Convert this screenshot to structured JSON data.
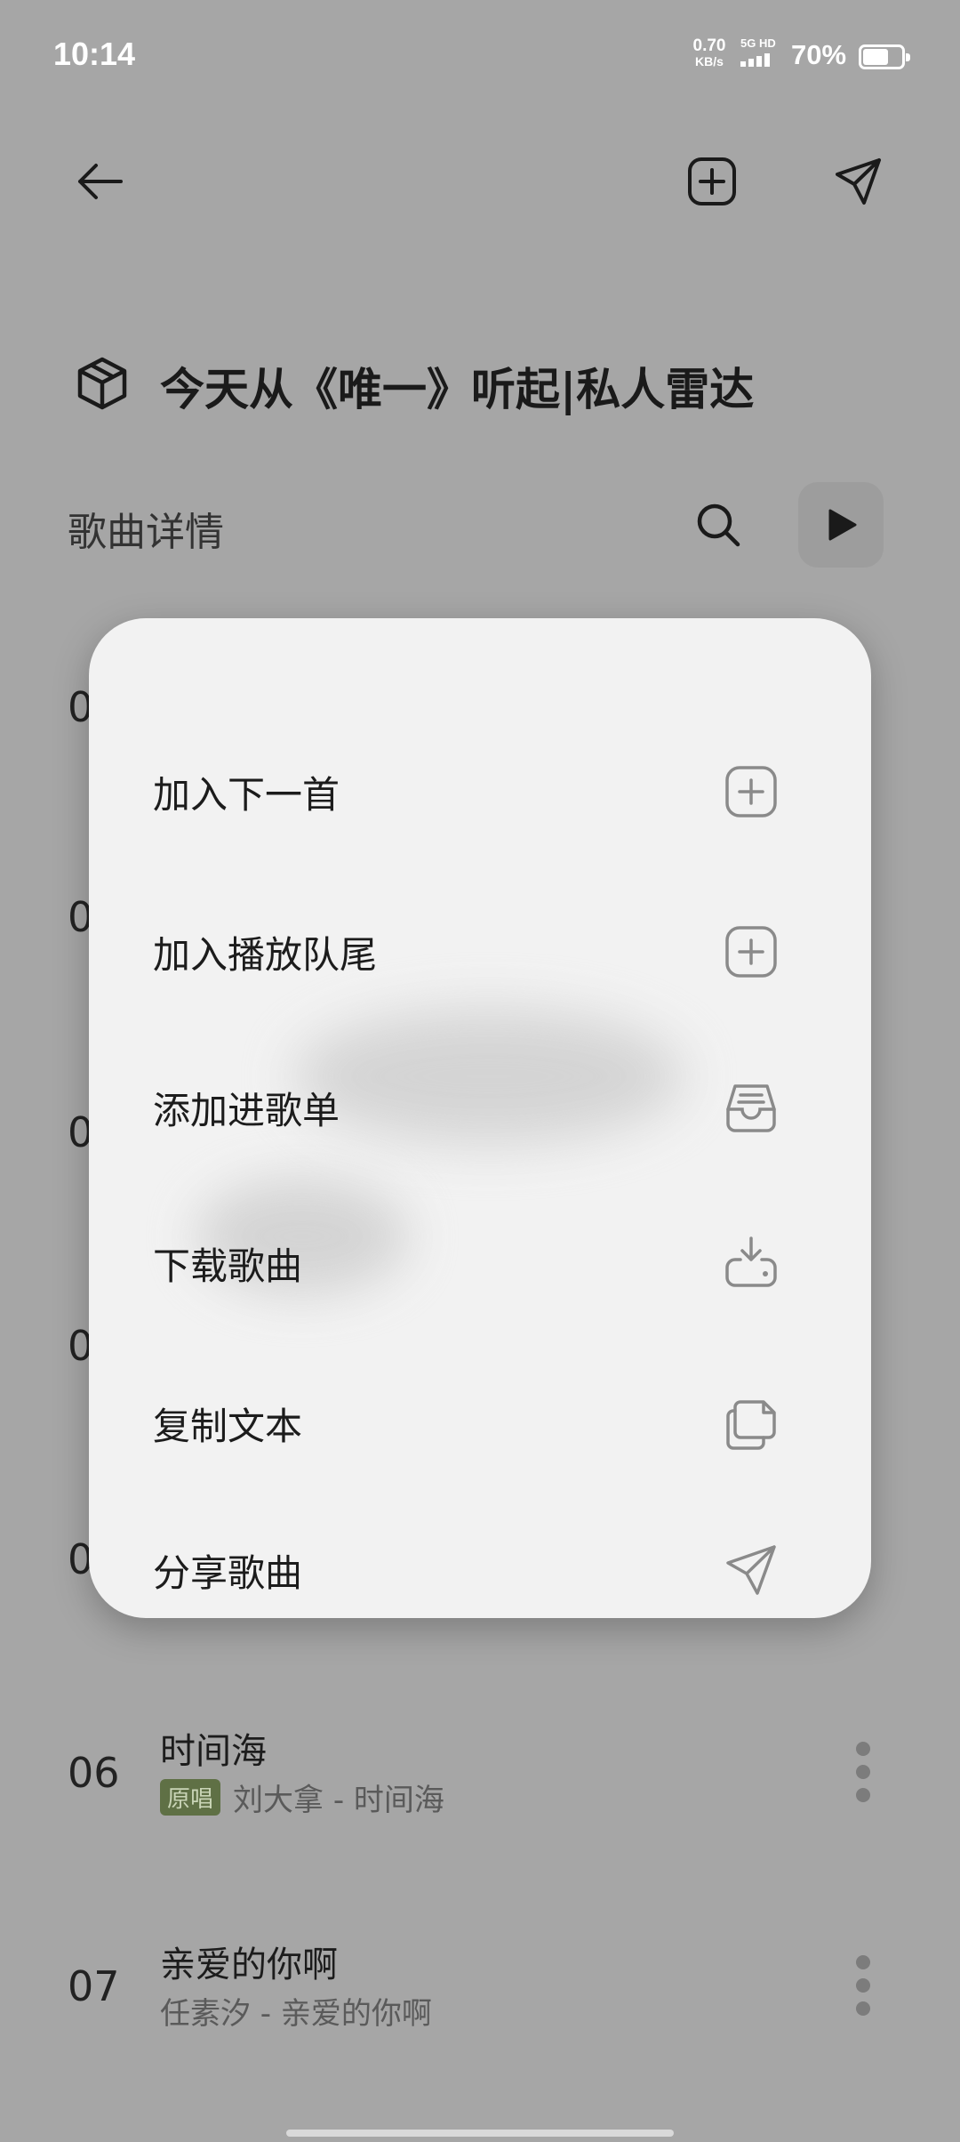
{
  "status_bar": {
    "time": "10:14",
    "net_speed_value": "0.70",
    "net_speed_unit": "KB/s",
    "network_type": "5G HD",
    "battery_percent": "70%",
    "battery_level": 0.7
  },
  "playlist": {
    "title": "今天从《唯一》听起|私人雷达",
    "section_label": "歌曲详情"
  },
  "hidden_row_numbers": [
    "0",
    "0",
    "0",
    "0",
    "0"
  ],
  "songs": [
    {
      "number": "06",
      "title": "时间海",
      "badge": "原唱",
      "subtitle": "刘大拿 - 时间海"
    },
    {
      "number": "07",
      "title": "亲爱的你啊",
      "badge": "",
      "subtitle": "任素汐 - 亲爱的你啊"
    }
  ],
  "context_menu": {
    "items": [
      {
        "label": "加入下一首",
        "icon": "plus-square-icon"
      },
      {
        "label": "加入播放队尾",
        "icon": "plus-square-icon"
      },
      {
        "label": "添加进歌单",
        "icon": "inbox-tray-icon"
      },
      {
        "label": "下载歌曲",
        "icon": "download-icon"
      },
      {
        "label": "复制文本",
        "icon": "copy-icon"
      },
      {
        "label": "分享歌曲",
        "icon": "send-icon"
      }
    ]
  },
  "colors": {
    "dim_background": "#a6a6a6",
    "menu_background": "#f2f2f2",
    "badge_background": "#5f7045",
    "menu_icon": "#8a8a8a"
  }
}
